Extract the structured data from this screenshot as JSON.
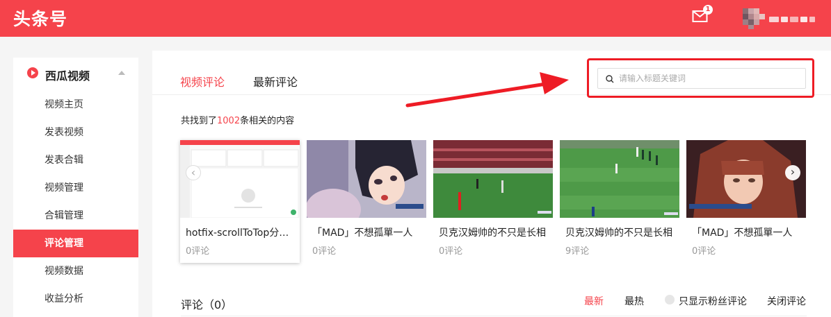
{
  "header": {
    "logo": "头条号",
    "mail_badge": "1",
    "brand_color": "#f5434b"
  },
  "sidebar": {
    "section_title": "西瓜视频",
    "items": [
      {
        "label": "视频主页"
      },
      {
        "label": "发表视频"
      },
      {
        "label": "发表合辑"
      },
      {
        "label": "视频管理"
      },
      {
        "label": "合辑管理"
      },
      {
        "label": "评论管理"
      },
      {
        "label": "视频数据"
      },
      {
        "label": "收益分析"
      }
    ],
    "active_item": "评论管理"
  },
  "main": {
    "tabs": [
      {
        "label": "视频评论"
      },
      {
        "label": "最新评论"
      }
    ],
    "search": {
      "placeholder": "请输入标题关键词"
    },
    "result": {
      "prefix": "共找到了",
      "count": "1002",
      "suffix": "条相关的内容"
    },
    "videos": [
      {
        "title": "hotfix-scrollToTop分支调试",
        "comments": "0评论",
        "thumb": "screenshot"
      },
      {
        "title": "「MAD」不想孤單一人",
        "comments": "0评论",
        "thumb": "anime-boy"
      },
      {
        "title": "贝克汉姆帅的不只是长相",
        "comments": "0评论",
        "thumb": "football-stadium"
      },
      {
        "title": "贝克汉姆帅的不只是长相",
        "comments": "9评论",
        "thumb": "football-field"
      },
      {
        "title": "「MAD」不想孤單一人",
        "comments": "0评论",
        "thumb": "anime-girl"
      }
    ],
    "comments_header": "评论（0）",
    "filters": {
      "latest": "最新",
      "hottest": "最热",
      "fans_only": "只显示粉丝评论",
      "close": "关闭评论"
    }
  }
}
